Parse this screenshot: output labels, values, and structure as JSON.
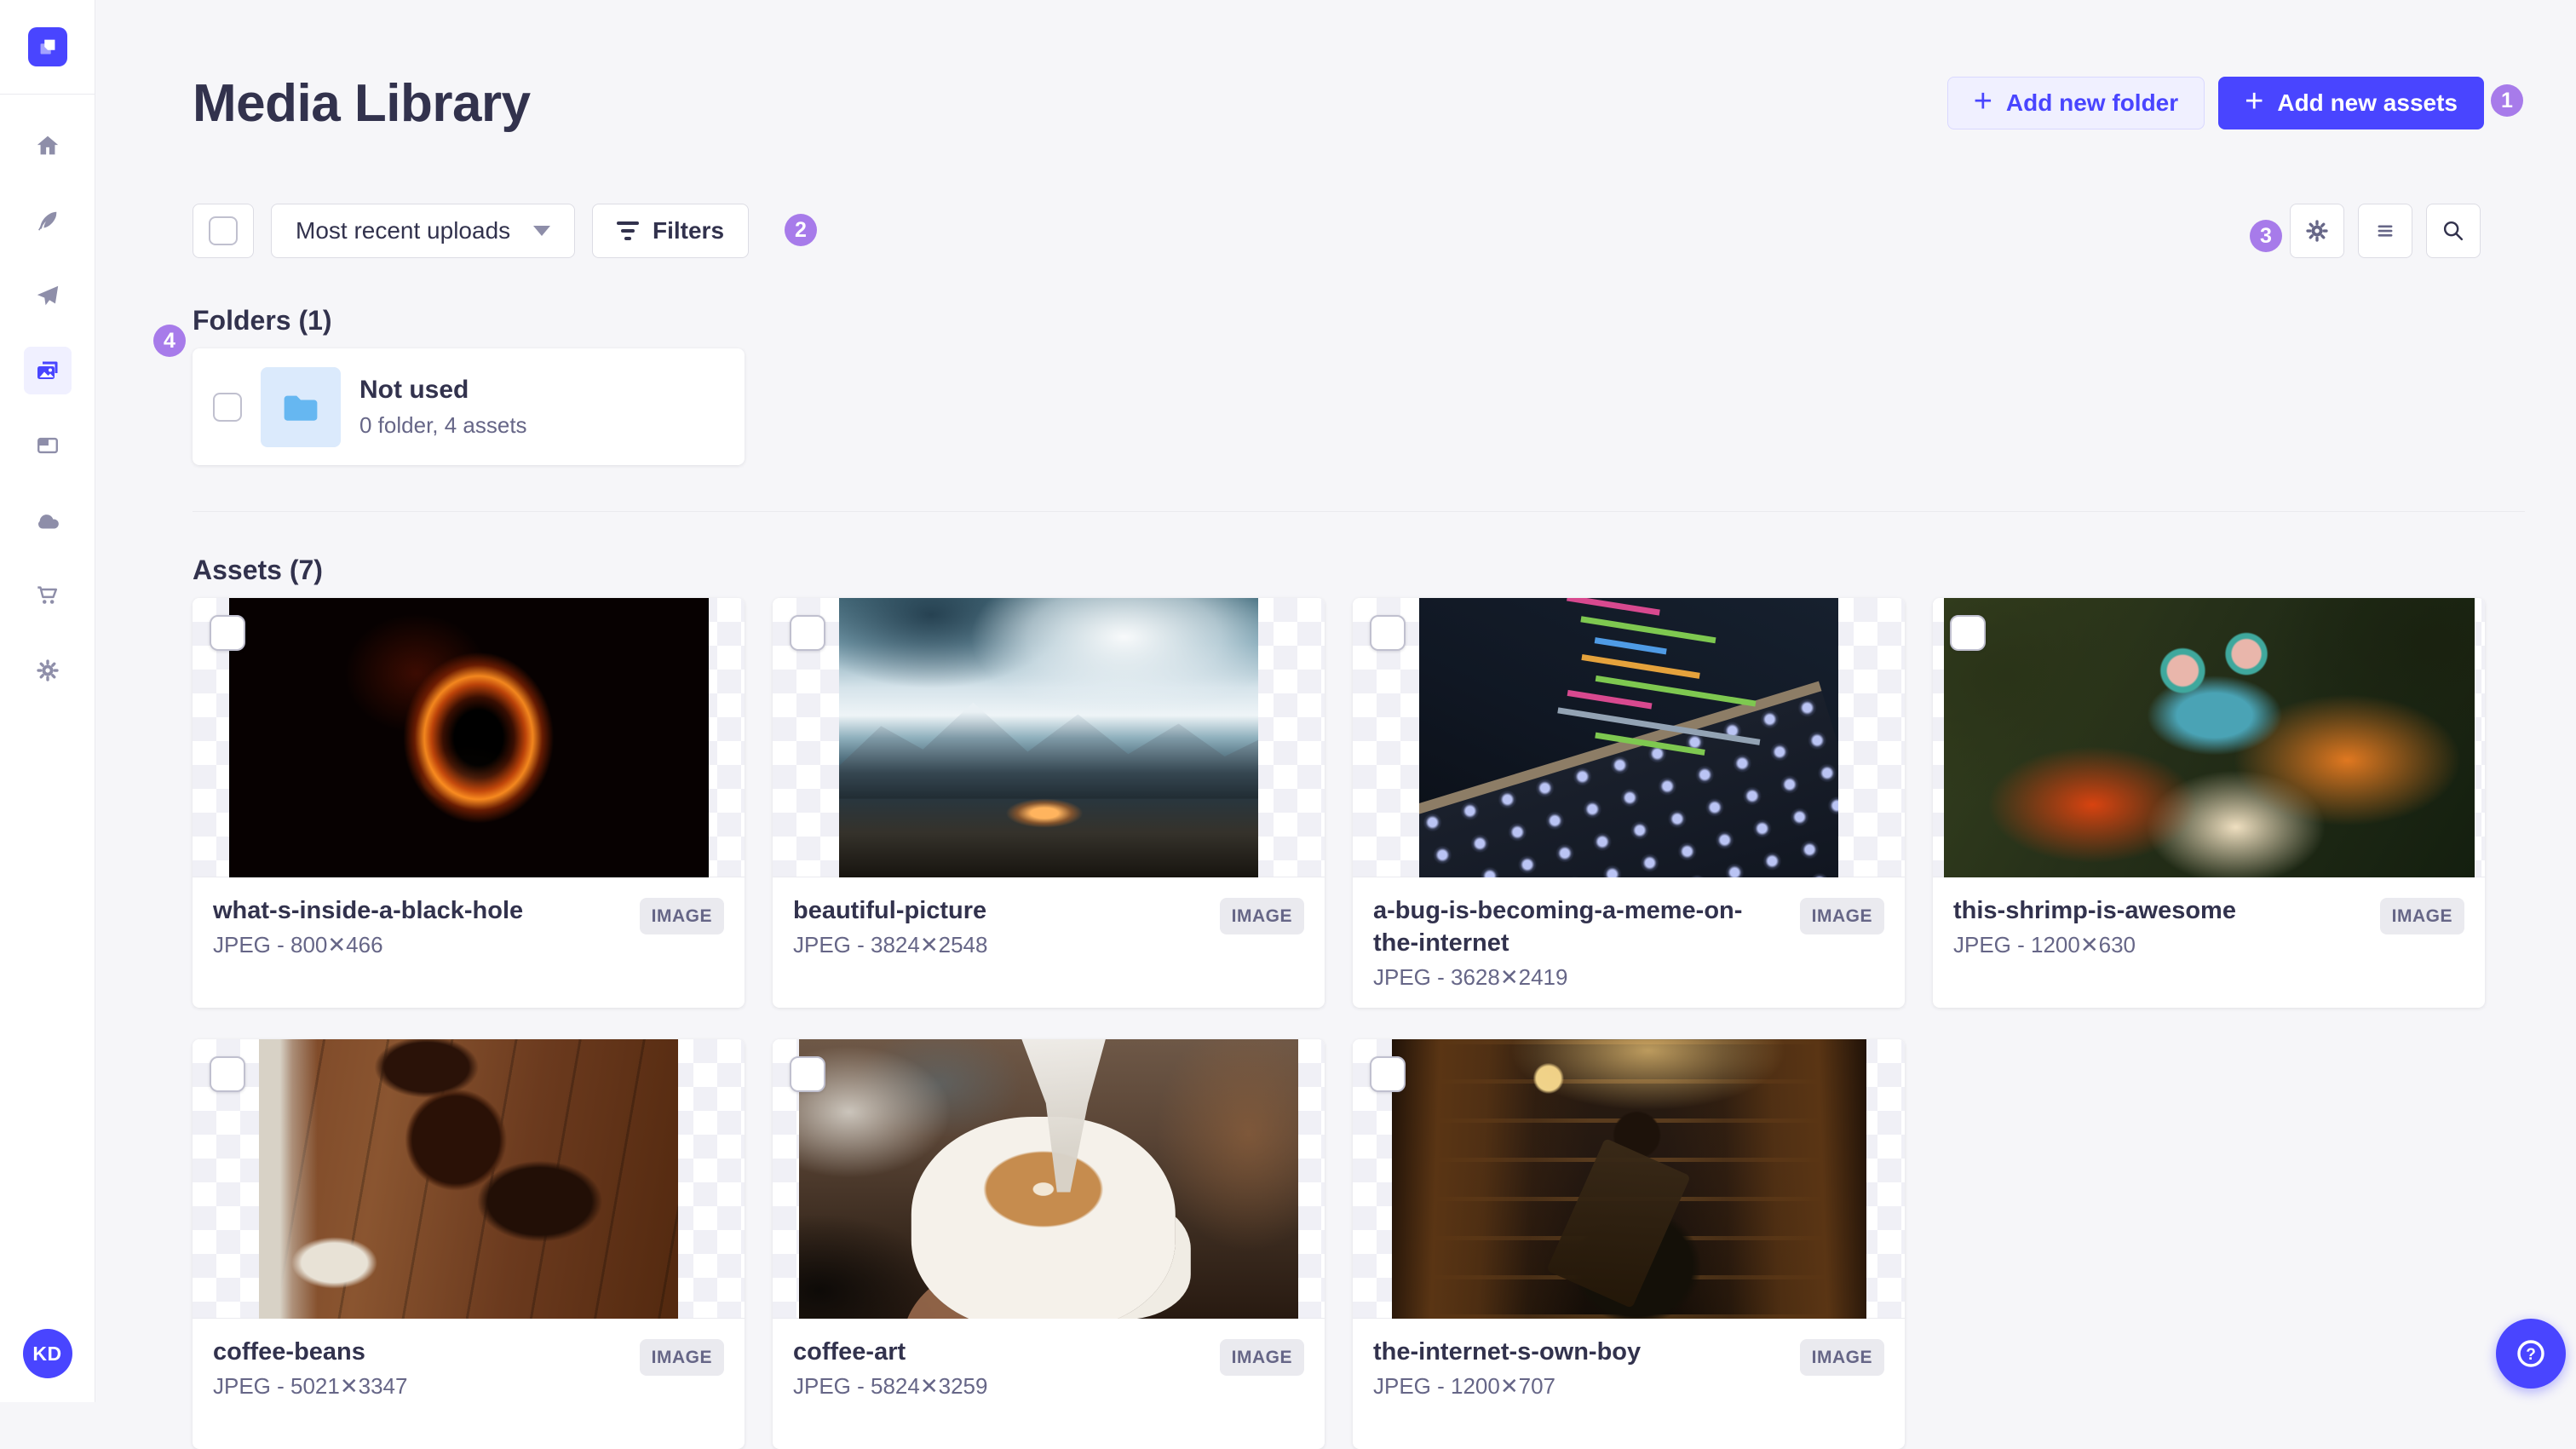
{
  "page": {
    "title": "Media Library"
  },
  "header": {
    "add_folder_label": "Add new folder",
    "add_assets_label": "Add new assets"
  },
  "controls": {
    "sort_value": "Most recent uploads",
    "filters_label": "Filters"
  },
  "folders": {
    "heading": "Folders (1)",
    "items": [
      {
        "name": "Not used",
        "meta": "0 folder, 4 assets"
      }
    ]
  },
  "assets": {
    "heading": "Assets (7)",
    "type_badge": "IMAGE",
    "items": [
      {
        "name": "what-s-inside-a-black-hole",
        "meta": "JPEG - 800✕466",
        "thumb": "blackhole"
      },
      {
        "name": "beautiful-picture",
        "meta": "JPEG - 3824✕2548",
        "thumb": "mountains"
      },
      {
        "name": "a-bug-is-becoming-a-meme-on-the-internet",
        "meta": "JPEG - 3628✕2419",
        "thumb": "laptop"
      },
      {
        "name": "this-shrimp-is-awesome",
        "meta": "JPEG - 1200✕630",
        "thumb": "shrimp"
      },
      {
        "name": "coffee-beans",
        "meta": "JPEG - 5021✕3347",
        "thumb": "beans"
      },
      {
        "name": "coffee-art",
        "meta": "JPEG - 5824✕3259",
        "thumb": "latte"
      },
      {
        "name": "the-internet-s-own-boy",
        "meta": "JPEG - 1200✕707",
        "thumb": "library"
      }
    ]
  },
  "annotations": [
    {
      "n": "1"
    },
    {
      "n": "2"
    },
    {
      "n": "3"
    },
    {
      "n": "4"
    }
  ],
  "user": {
    "initials": "KD"
  },
  "colors": {
    "primary": "#4945ff",
    "primary_light_bg": "#f0f0ff",
    "annotation_purple": "#a77bea",
    "text_dark": "#32324d",
    "text_muted": "#666687",
    "folder_icon_blue": "#66b7f1"
  }
}
